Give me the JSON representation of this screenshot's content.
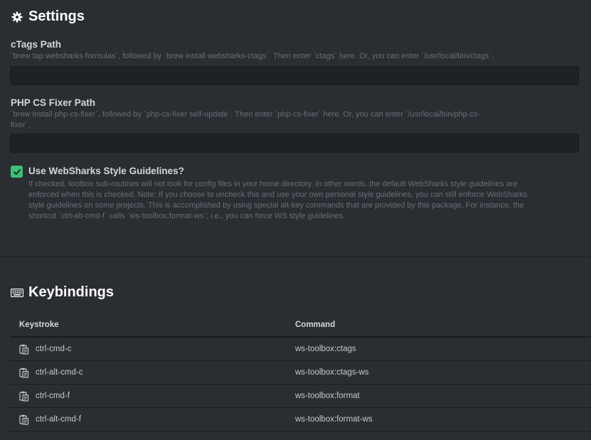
{
  "settings": {
    "title": "Settings",
    "ctags": {
      "label": "cTags Path",
      "description": "`brew tap websharks-formulas`, followed by `brew install websharks-ctags`. Then enter `ctags` here. Or, you can enter `/usr/local/bin/ctags`.",
      "value": ""
    },
    "phpcs": {
      "label": "PHP CS Fixer Path",
      "description_line1": "`brew install php-cs-fixer`, followed by `php-cs-fixer self-update`. Then enter `php-cs-fixer` here. Or, you can enter `/usr/local/bin/php-cs-",
      "description_line2": "fixer`.",
      "value": ""
    },
    "style": {
      "label": "Use WebSharks Style Guidelines?",
      "checked": true,
      "description_line1": "If checked, toolbox sub-routines will not look for config files in your home directory. In other words, the default WebSharks style guidelines are",
      "description_line2": "enforced when this is checked. Note: If you choose to uncheck this and use your own personal style guidelines, you can still enforce WebSharks",
      "description_line3": "style guidelines on some projects. This is accomplished by using special alt-key commands that are provided by this package. For instance, the",
      "description_line4": "shortcut `ctrl-alt-cmd-f` calls `ws-toolbox:format-ws`; i.e., you can force WS style guidelines."
    }
  },
  "keybindings": {
    "title": "Keybindings",
    "headers": {
      "keystroke": "Keystroke",
      "command": "Command"
    },
    "rows": [
      {
        "keystroke": "ctrl-cmd-c",
        "command": "ws-toolbox:ctags"
      },
      {
        "keystroke": "ctrl-alt-cmd-c",
        "command": "ws-toolbox:ctags-ws"
      },
      {
        "keystroke": "ctrl-cmd-f",
        "command": "ws-toolbox:format"
      },
      {
        "keystroke": "ctrl-alt-cmd-f",
        "command": "ws-toolbox:format-ws"
      }
    ]
  },
  "colors": {
    "background": "#2a2d32",
    "checkbox": "#3fbf7a",
    "input": "#1e2125"
  },
  "icons": {
    "settings": "gear-icon",
    "keybindings": "keyboard-icon",
    "row": "clipboard-copy-icon"
  }
}
